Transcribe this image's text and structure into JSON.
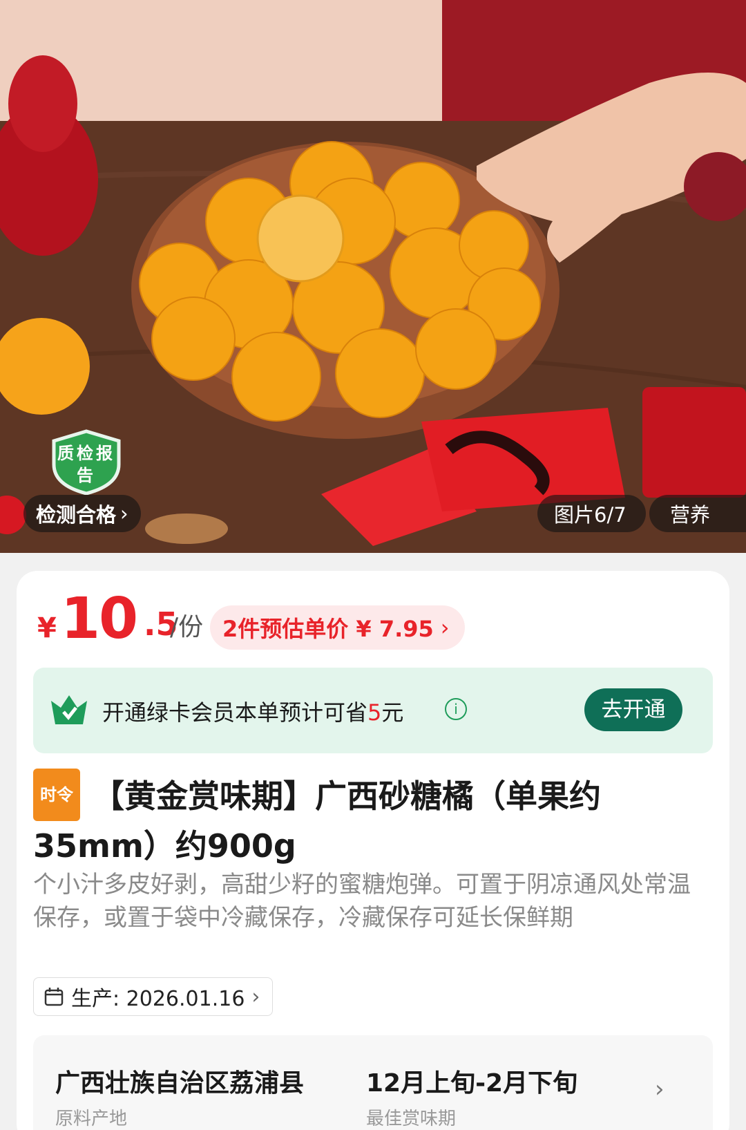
{
  "hero": {
    "quality_badge": "质检报告",
    "check_label": "检测合格",
    "photo_counter": "图片6/7",
    "nutrition_tab": "营养",
    "chevron": "›"
  },
  "price": {
    "currency": "¥",
    "integer": "10",
    "decimal": ".5",
    "unit": "/份",
    "promo_text": "2件预估单价 ¥ 7.95",
    "promo_chevron": "›"
  },
  "membership": {
    "text_before": "开通绿卡会员本单预计可省",
    "save_amount": "5",
    "text_after": "元",
    "info_glyph": "i",
    "button_label": "去开通",
    "brand_color": "#0f6f57"
  },
  "product": {
    "tag": "时令",
    "title": "【黄金赏味期】广西砂糖橘（单果约35mm）约900g",
    "description": "个小汁多皮好剥，高甜少籽的蜜糖炮弹。可置于阴凉通风处常温保存，或置于袋中冷藏保存，冷藏保存可延长保鲜期",
    "production_label": "生产: 2026.01.16",
    "production_chevron": "›"
  },
  "origin": {
    "place": "广西壮族自治区荔浦县",
    "season": "12月上旬-2月下旬",
    "place_sub": "原料产地",
    "season_sub": "最佳赏味期",
    "chevron": "›"
  },
  "colors": {
    "price_red": "#e8232a",
    "member_bg": "#e3f5ec",
    "tag_orange": "#f28b1c"
  }
}
